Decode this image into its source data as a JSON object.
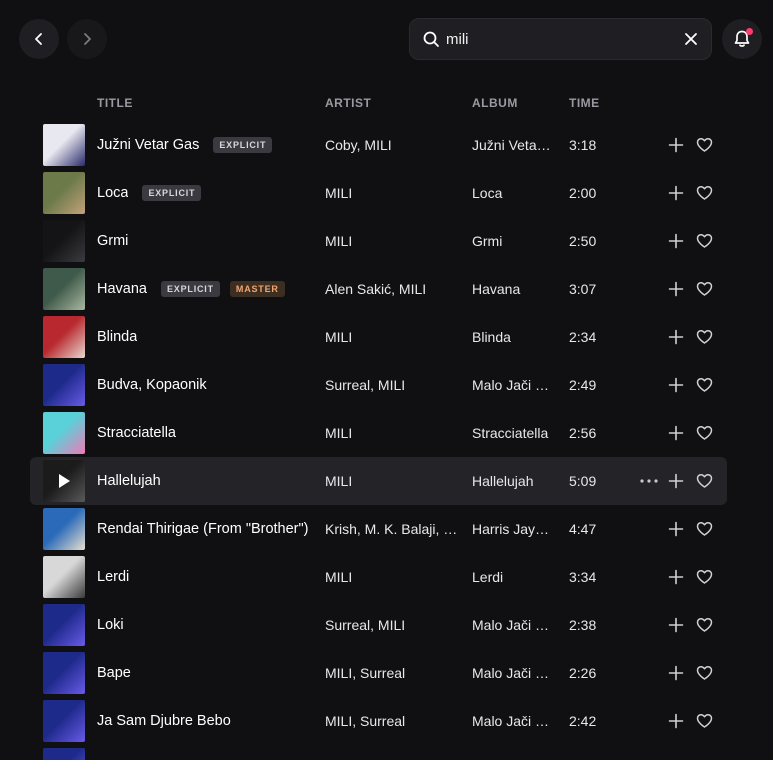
{
  "search": {
    "query": "mili"
  },
  "columns": {
    "title": "TITLE",
    "artist": "ARTIST",
    "album": "ALBUM",
    "time": "TIME"
  },
  "tracks": [
    {
      "title": "Južni Vetar Gas",
      "badges": [
        "EXPLICIT"
      ],
      "artist": "Coby, MILI",
      "album": "Južni Vetar Gas",
      "time": "3:18",
      "cover_color": "#e8e8f0",
      "cover_accent": "#2a2a6a"
    },
    {
      "title": "Loca",
      "badges": [
        "EXPLICIT"
      ],
      "artist": "MILI",
      "album": "Loca",
      "time": "2:00",
      "cover_color": "#6c7a4a",
      "cover_accent": "#c4a27a"
    },
    {
      "title": "Grmi",
      "badges": [],
      "artist": "MILI",
      "album": "Grmi",
      "time": "2:50",
      "cover_color": "#141416",
      "cover_accent": "#3a3a40"
    },
    {
      "title": "Havana",
      "badges": [
        "EXPLICIT",
        "MASTER"
      ],
      "artist": "Alen Sakić, MILI",
      "album": "Havana",
      "time": "3:07",
      "cover_color": "#3f5a4a",
      "cover_accent": "#a8b8a0"
    },
    {
      "title": "Blinda",
      "badges": [],
      "artist": "MILI",
      "album": "Blinda",
      "time": "2:34",
      "cover_color": "#b8282e",
      "cover_accent": "#e8d8d0"
    },
    {
      "title": "Budva, Kopaonik",
      "badges": [],
      "artist": "Surreal, MILI",
      "album": "Malo Jači Gas",
      "time": "2:49",
      "cover_color": "#1d2a8a",
      "cover_accent": "#6a5ae8"
    },
    {
      "title": "Stracciatella",
      "badges": [],
      "artist": "MILI",
      "album": "Stracciatella",
      "time": "2:56",
      "cover_color": "#5ad0d8",
      "cover_accent": "#f07ab8"
    },
    {
      "title": "Hallelujah",
      "badges": [],
      "artist": "MILI",
      "album": "Hallelujah",
      "time": "5:09",
      "cover_color": "#2a2a2c",
      "cover_accent": "#8a8a8a",
      "hover": true
    },
    {
      "title": "Rendai Thirigae (From \"Brother\")",
      "badges": [],
      "artist": "Krish, M. K. Balaji, Harris Jayaraj",
      "album": "Harris Jayaraj",
      "time": "4:47",
      "cover_color": "#2a6ab8",
      "cover_accent": "#e8e0d0"
    },
    {
      "title": "Lerdi",
      "badges": [],
      "artist": "MILI",
      "album": "Lerdi",
      "time": "3:34",
      "cover_color": "#d8d8d8",
      "cover_accent": "#3a3a3a"
    },
    {
      "title": "Loki",
      "badges": [],
      "artist": "Surreal, MILI",
      "album": "Malo Jači Gas",
      "time": "2:38",
      "cover_color": "#1d2a8a",
      "cover_accent": "#6a5ae8"
    },
    {
      "title": "Bape",
      "badges": [],
      "artist": "MILI, Surreal",
      "album": "Malo Jači Gas",
      "time": "2:26",
      "cover_color": "#1d2a8a",
      "cover_accent": "#6a5ae8"
    },
    {
      "title": "Ja Sam Djubre Bebo",
      "badges": [],
      "artist": "MILI, Surreal",
      "album": "Malo Jači Gas",
      "time": "2:42",
      "cover_color": "#1d2a8a",
      "cover_accent": "#6a5ae8"
    },
    {
      "title": "",
      "badges": [],
      "artist": "",
      "album": "",
      "time": "",
      "cover_color": "#1d2a8a",
      "cover_accent": "#6a5ae8"
    }
  ]
}
